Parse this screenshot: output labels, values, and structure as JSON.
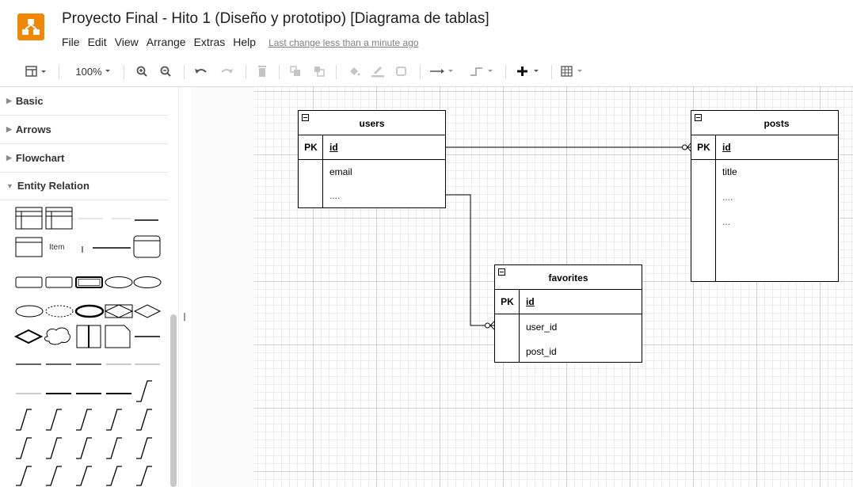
{
  "app": {
    "title": "Proyecto Final - Hito 1 (Diseño y prototipo) [Diagrama de tablas]",
    "menu": [
      "File",
      "Edit",
      "View",
      "Arrange",
      "Extras",
      "Help"
    ],
    "last_change": "Last change less than a minute ago",
    "brand_color": "#f08705"
  },
  "toolbar": {
    "zoom": "100%",
    "icons": [
      "view-panels-icon",
      "zoom-in-icon",
      "zoom-out-icon",
      "undo-icon",
      "redo-icon",
      "delete-icon",
      "to-front-icon",
      "to-back-icon",
      "fill-color-icon",
      "line-color-icon",
      "shadow-icon",
      "connection-icon",
      "waypoints-icon",
      "insert-icon",
      "table-icon"
    ]
  },
  "sidebar": {
    "sections": [
      {
        "label": "Basic",
        "expanded": false
      },
      {
        "label": "Arrows",
        "expanded": false
      },
      {
        "label": "Flowchart",
        "expanded": false
      },
      {
        "label": "Entity Relation",
        "expanded": true
      }
    ],
    "shape_item_label": "Item"
  },
  "diagram": {
    "tables": [
      {
        "name": "users",
        "pk_key": "PK",
        "pk": "id",
        "fields": [
          "email",
          "...."
        ]
      },
      {
        "name": "posts",
        "pk_key": "PK",
        "pk": "id",
        "fields": [
          "title",
          "....",
          "..."
        ]
      },
      {
        "name": "favorites",
        "pk_key": "PK",
        "pk": "id",
        "fields": [
          "user_id",
          "post_id"
        ]
      }
    ]
  }
}
